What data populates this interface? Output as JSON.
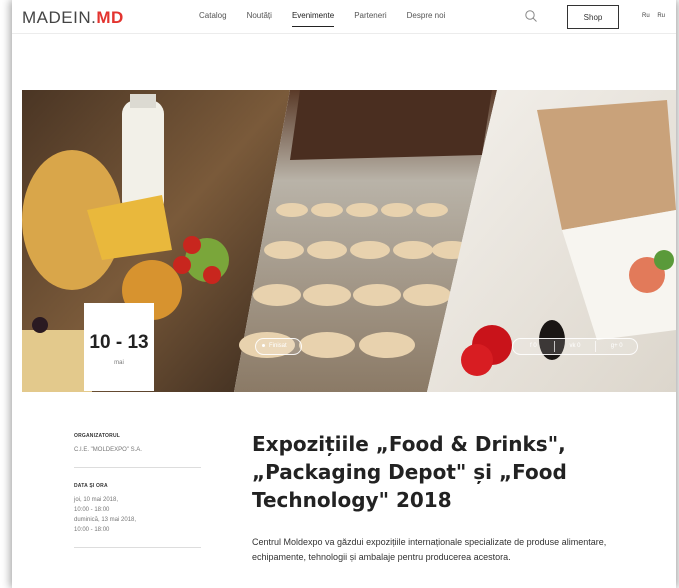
{
  "header": {
    "logo_main": "MADEIN.",
    "logo_accent": "MD",
    "nav": [
      "Catalog",
      "Noutăți",
      "Evenimente",
      "Parteneri",
      "Despre noi"
    ],
    "active_nav": "Evenimente",
    "shop_label": "Shop",
    "langs": [
      "Ru",
      "Ru"
    ]
  },
  "event": {
    "date_range": "10 - 13",
    "date_month": "mai",
    "status": "Finisat",
    "share": {
      "facebook": "0",
      "vk": "0",
      "gplus": "0"
    },
    "organizer_label": "ORGANIZATORUL",
    "organizer_value": "C.I.E. \"MOLDEXPO\" S.A.",
    "datetime_label": "DATA ȘI ORA",
    "datetime_lines": [
      "joi, 10 mai 2018,",
      "10:00 - 18:00",
      "duminică, 13 mai 2018,",
      "10:00 - 18:00"
    ],
    "title": "Expozițiile „Food & Drinks\", „Packaging Depot\" și „Food Technology\" 2018",
    "description": "Centrul Moldexpo va găzdui expozițiile internaționale specializate de produse alimentare, echipamente, tehnologii și ambalaje pentru producerea acestora."
  },
  "colors": {
    "accent": "#e3342f"
  },
  "icons": {
    "search": "search-icon",
    "facebook": "facebook-icon",
    "vk": "vk-icon",
    "gplus": "google-plus-icon"
  }
}
